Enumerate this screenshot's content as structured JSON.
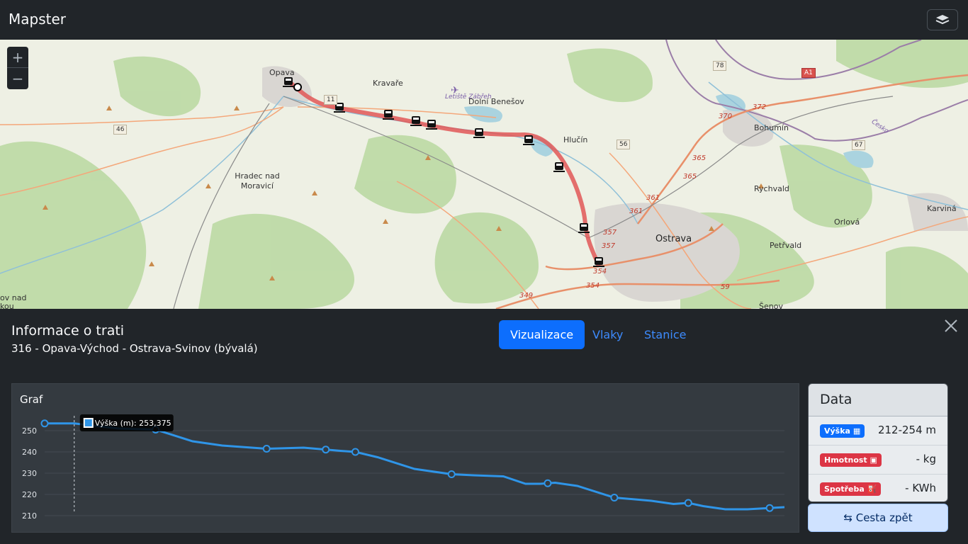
{
  "app": {
    "title": "Mapster"
  },
  "map": {
    "zoom_in": "+",
    "zoom_out": "−",
    "places": [
      "Opava",
      "Kravaře",
      "Dolní Benešov",
      "Letiště Zábřeh",
      "Hlučín",
      "Bohumín",
      "Hradec nad Moravicí",
      "Rychvald",
      "Karviná",
      "Orlová",
      "Ostrava",
      "Petřvald",
      "Šenov",
      "ov nad",
      "kou",
      "Česko"
    ],
    "road_labels": [
      "46",
      "11",
      "56",
      "78",
      "67",
      "A1",
      "370",
      "372",
      "365",
      "365",
      "361",
      "361",
      "357",
      "357",
      "354",
      "354",
      "349",
      "59"
    ]
  },
  "panel": {
    "title": "Informace o trati",
    "subtitle": "316 - Opava-Východ - Ostrava-Svinov (bývalá)",
    "tabs": [
      "Vizualizace",
      "Vlaky",
      "Stanice"
    ]
  },
  "graph": {
    "title": "Graf",
    "tooltip": "Výška (m): 253,375"
  },
  "chart_data": {
    "type": "line",
    "title": "Graf",
    "series": [
      {
        "name": "Výška (m)"
      }
    ],
    "ylim": [
      207,
      257
    ],
    "yticks": [
      "250",
      "240",
      "230",
      "220",
      "210"
    ],
    "x": [
      0,
      4,
      10,
      15,
      20,
      24,
      30,
      35,
      40,
      42,
      45,
      50,
      55,
      58,
      62,
      65,
      67,
      69,
      72,
      77,
      82,
      85,
      87,
      89,
      92,
      95,
      100
    ],
    "y": [
      253.4,
      253.4,
      251,
      250.5,
      245,
      243,
      241.5,
      242,
      240.5,
      240,
      237.5,
      232,
      229.5,
      229,
      228.5,
      225,
      225,
      225.5,
      224,
      218.5,
      217,
      215.5,
      216,
      214.5,
      213,
      213,
      214
    ],
    "marker_x": [
      0,
      15,
      30,
      38,
      42,
      55,
      68,
      77,
      87,
      98
    ]
  },
  "data_card": {
    "title": "Data",
    "rows": [
      {
        "badge": "Výška",
        "value": "212-254 m",
        "color": "#0d6efd"
      },
      {
        "badge": "Hmotnost",
        "value": "- kg",
        "color": "#dc3545"
      },
      {
        "badge": "Spotřeba",
        "value": "- KWh",
        "color": "#dc3545"
      }
    ],
    "back_button": "Cesta zpět"
  }
}
